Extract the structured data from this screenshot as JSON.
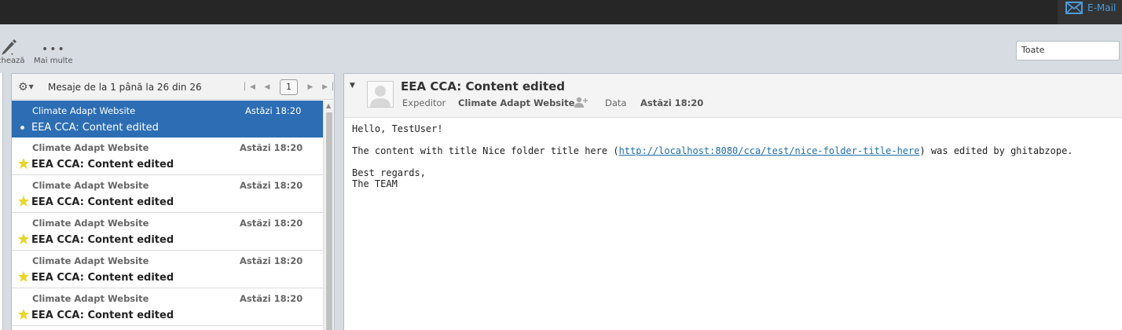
{
  "topbar": {
    "email_label": "E-Mail"
  },
  "toolbar": {
    "edit_label": "chează",
    "more_label": "Mai multe",
    "more_dots": "•••"
  },
  "filter": {
    "value": "Toate"
  },
  "list": {
    "count_text": "Mesaje de la 1 până la 26 din 26",
    "page": "1",
    "messages": [
      {
        "from": "Climate Adapt Website",
        "date": "Astăzi 18:20",
        "subject": "EEA CCA: Content edited",
        "selected": true
      },
      {
        "from": "Climate Adapt Website",
        "date": "Astăzi 18:20",
        "subject": "EEA CCA: Content edited",
        "flagged": true
      },
      {
        "from": "Climate Adapt Website",
        "date": "Astăzi 18:20",
        "subject": "EEA CCA: Content edited",
        "flagged": true
      },
      {
        "from": "Climate Adapt Website",
        "date": "Astăzi 18:20",
        "subject": "EEA CCA: Content edited",
        "flagged": true
      },
      {
        "from": "Climate Adapt Website",
        "date": "Astăzi 18:20",
        "subject": "EEA CCA: Content edited",
        "flagged": true
      },
      {
        "from": "Climate Adapt Website",
        "date": "Astăzi 18:20",
        "subject": "EEA CCA: Content edited",
        "flagged": true
      }
    ]
  },
  "reader": {
    "subject": "EEA CCA: Content edited",
    "from_label": "Expeditor",
    "from_value": "Climate Adapt Website",
    "date_label": "Data",
    "date_value": "Astăzi 18:20",
    "body": {
      "greeting": "Hello, TestUser!",
      "line_prefix": "The content with title Nice folder title here (",
      "link": "http://localhost:8080/cca/test/nice-folder-title-here",
      "line_suffix": ") was edited by ghitabzope.",
      "regards": "Best regards,",
      "signature": "The TEAM"
    }
  },
  "colors": {
    "selected_row": "#2d6db4",
    "star": "#e8d62a",
    "link": "#1f6fa7",
    "email_accent": "#4a9bd9"
  }
}
